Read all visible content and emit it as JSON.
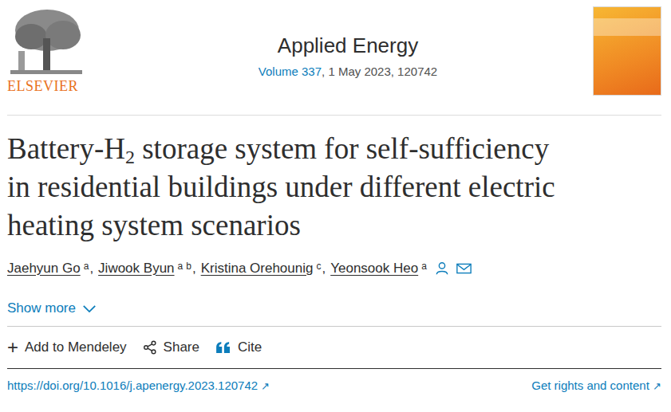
{
  "publisher": {
    "name": "ELSEVIER"
  },
  "journal": {
    "name": "Applied Energy",
    "volume": "Volume 337",
    "issue_info": ", 1 May 2023, 120742"
  },
  "title": {
    "lines": [
      [
        {
          "text": "Battery-H",
          "sub": false
        },
        {
          "text": "2",
          "sub": true
        },
        {
          "text": " storage system for self-sufficiency",
          "sub": false
        }
      ],
      [
        {
          "text": "in residential buildings under different electric",
          "sub": false
        }
      ],
      [
        {
          "text": "heating system scenarios",
          "sub": false
        }
      ]
    ]
  },
  "authors": [
    {
      "name": "Jaehyun Go",
      "affiliations": [
        "a"
      ],
      "separator": ",",
      "corresponding": false
    },
    {
      "name": "Jiwook Byun",
      "affiliations": [
        "a",
        "b"
      ],
      "separator": ",",
      "corresponding": false
    },
    {
      "name": "Kristina Orehounig",
      "affiliations": [
        "c"
      ],
      "separator": ",",
      "corresponding": false
    },
    {
      "name": "Yeonsook Heo",
      "affiliations": [
        "a"
      ],
      "separator": "",
      "corresponding": true
    }
  ],
  "show_more": {
    "label": "Show more",
    "expanded": false
  },
  "actions": [
    {
      "label": "Add to Mendeley",
      "glyph": "+",
      "kind": "glyph"
    },
    {
      "label": "Share",
      "glyph": "",
      "kind": "share"
    },
    {
      "label": "Cite",
      "glyph": "",
      "kind": "cite"
    }
  ],
  "doi": {
    "url": "https://doi.org/10.1016/j.apenergy.2023.120742",
    "arrow": "↗"
  },
  "rights": {
    "label": "Get rights and content",
    "arrow": "↗"
  }
}
